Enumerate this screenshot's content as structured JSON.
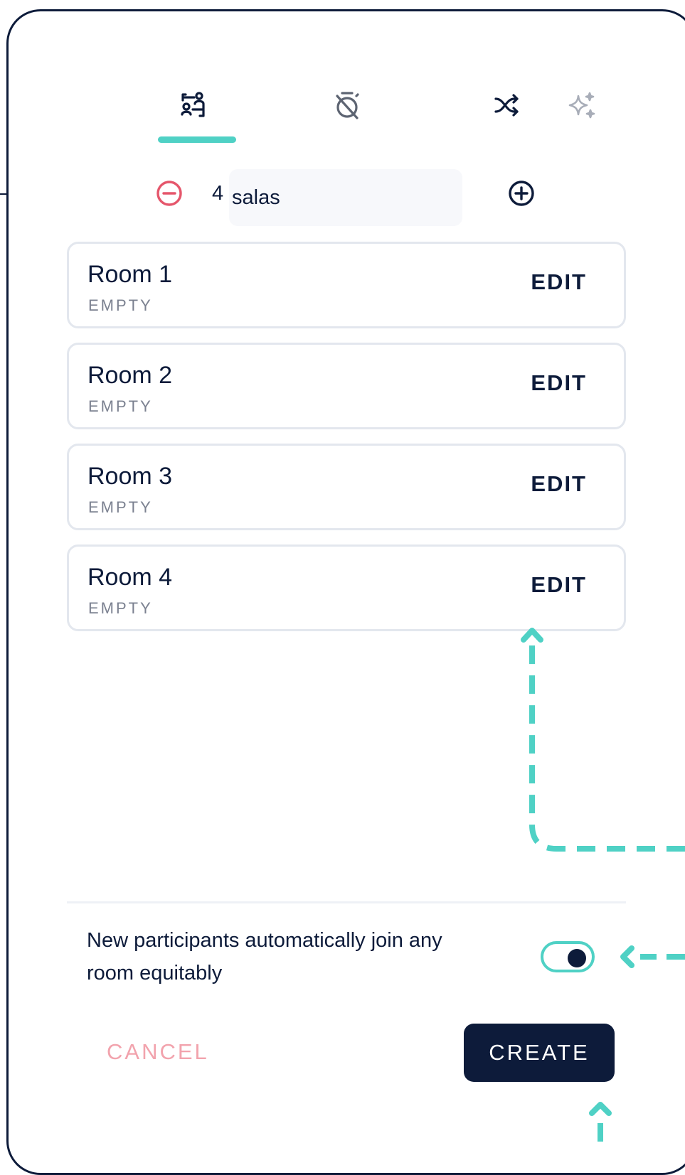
{
  "tabs": [
    {
      "icon": "breakout-rooms-icon",
      "active": true
    },
    {
      "icon": "timer-off-icon",
      "active": false
    },
    {
      "icon": "shuffle-icon",
      "active": false
    },
    {
      "icon": "sparkles-icon",
      "active": false
    }
  ],
  "counter": {
    "count": "4",
    "value": "salas"
  },
  "rooms": [
    {
      "name": "Room 1",
      "status": "EMPTY",
      "action": "EDIT"
    },
    {
      "name": "Room 2",
      "status": "EMPTY",
      "action": "EDIT"
    },
    {
      "name": "Room 3",
      "status": "EMPTY",
      "action": "EDIT"
    },
    {
      "name": "Room 4",
      "status": "EMPTY",
      "action": "EDIT"
    }
  ],
  "auto_join": {
    "label": "New participants automatically join any room equitably",
    "enabled": true
  },
  "footer": {
    "cancel_label": "CANCEL",
    "create_label": "CREATE"
  },
  "colors": {
    "primary": "#0d1b3a",
    "accent": "#4fd1c5",
    "danger": "#e5566b",
    "cancel": "#f2a3ad",
    "border": "#e3e7ee"
  }
}
